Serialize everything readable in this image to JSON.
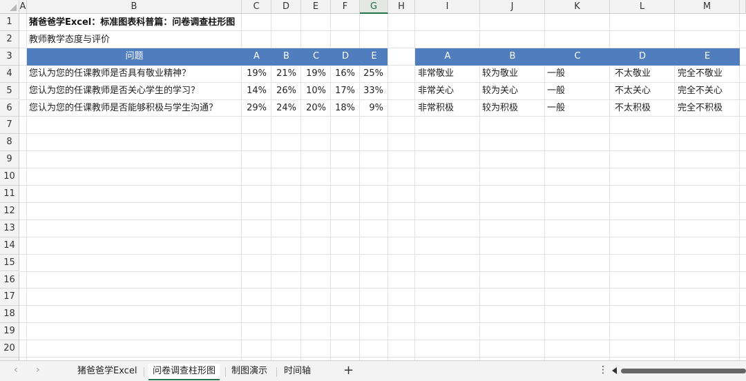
{
  "sheet": {
    "columns": [
      "A",
      "B",
      "C",
      "D",
      "E",
      "F",
      "G",
      "H",
      "I",
      "J",
      "K",
      "L",
      "M"
    ],
    "selected_column": "G",
    "rows": [
      "1",
      "2",
      "3",
      "4",
      "5",
      "6",
      "7",
      "8",
      "9",
      "10",
      "11",
      "12",
      "13",
      "14",
      "15",
      "16",
      "17",
      "18",
      "19",
      "20"
    ]
  },
  "content": {
    "title": "猪爸爸学Excel：标准图表科普篇：问卷调查柱形图",
    "subtitle": "教师教学态度与评价",
    "table_header": [
      "问题",
      "A",
      "B",
      "C",
      "D",
      "E"
    ],
    "table_rows": [
      {
        "question": "您认为您的任课教师是否具有敬业精神？",
        "values": [
          "19%",
          "21%",
          "19%",
          "16%",
          "25%"
        ]
      },
      {
        "question": "您认为您的任课教师是否关心学生的学习？",
        "values": [
          "14%",
          "26%",
          "10%",
          "17%",
          "33%"
        ]
      },
      {
        "question": "您认为您的任课教师是否能够积极与学生沟通？",
        "values": [
          "29%",
          "24%",
          "20%",
          "18%",
          "9%"
        ]
      }
    ],
    "legend_header": [
      "A",
      "B",
      "C",
      "D",
      "E"
    ],
    "legend_rows": [
      [
        "非常敬业",
        "较为敬业",
        "一般",
        "不太敬业",
        "完全不敬业"
      ],
      [
        "非常关心",
        "较为关心",
        "一般",
        "不太关心",
        "完全不关心"
      ],
      [
        "非常积极",
        "较为积极",
        "一般",
        "不太积极",
        "完全不积极"
      ]
    ]
  },
  "tabs": [
    {
      "label": "猪爸爸学Excel",
      "active": false
    },
    {
      "label": "问卷调查柱形图",
      "active": true
    },
    {
      "label": "制图演示",
      "active": false
    },
    {
      "label": "时间轴",
      "active": false
    }
  ],
  "controls": {
    "prev_icon": "chevron-left-icon",
    "next_icon": "chevron-right-icon",
    "add_label": "+",
    "more_label": "⋮"
  },
  "colors": {
    "header_fill": "#4f7dbd",
    "active_accent": "#217346"
  }
}
